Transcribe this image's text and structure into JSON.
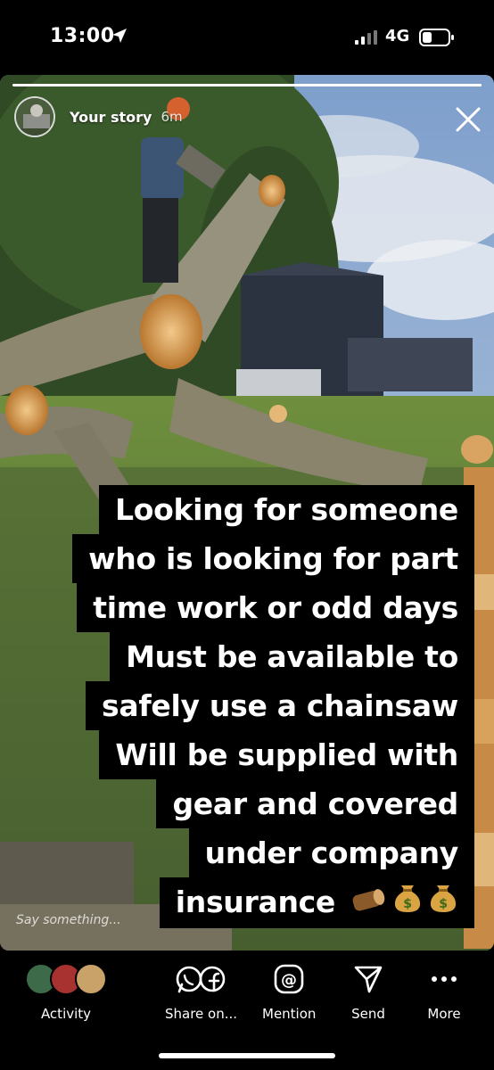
{
  "status_bar": {
    "time": "13:00",
    "network": "4G",
    "location_icon": "location-arrow-icon",
    "signal_icon": "signal-bars-icon",
    "battery_icon": "battery-low-icon"
  },
  "story": {
    "owner": "Your story",
    "age": "6m",
    "progress": 1.0,
    "caption_lines": [
      "Looking for someone",
      "who is looking for part",
      "time work or odd days",
      "Must be available to",
      "safely use a chainsaw",
      "Will be supplied with",
      "gear and covered",
      "under company",
      "insurance"
    ],
    "caption_emojis": [
      "wood-log-emoji",
      "money-bag-emoji",
      "money-bag-emoji"
    ],
    "reply_placeholder": "Say something...",
    "close_icon": "close-icon"
  },
  "bottom_bar": {
    "activity": "Activity",
    "share": "Share on...",
    "mention": "Mention",
    "send": "Send",
    "more": "More"
  },
  "colors": {
    "background": "#000000",
    "caption_bg": "#000000",
    "caption_text": "#ffffff"
  }
}
